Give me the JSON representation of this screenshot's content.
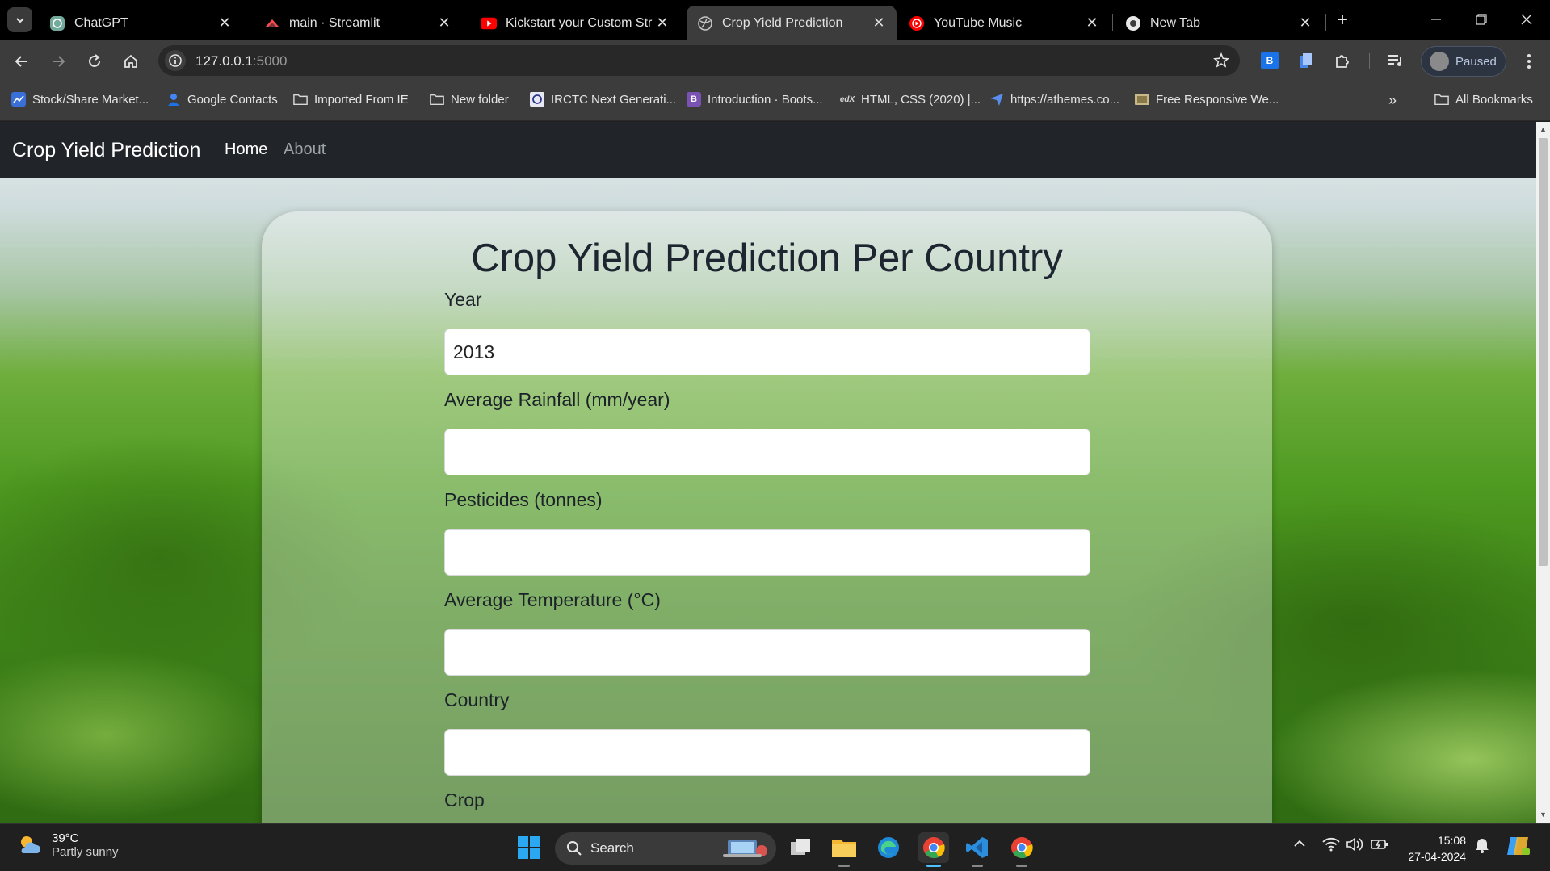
{
  "browser": {
    "tabs": [
      {
        "title": "ChatGPT",
        "icon": "chatgpt-icon",
        "active": false
      },
      {
        "title": "main · Streamlit",
        "icon": "streamlit-icon",
        "active": false
      },
      {
        "title": "Kickstart your Custom Strea",
        "icon": "youtube-icon",
        "active": false
      },
      {
        "title": "Crop Yield Prediction",
        "icon": "globe-icon",
        "active": true
      },
      {
        "title": "YouTube Music",
        "icon": "youtube-music-icon",
        "active": false
      },
      {
        "title": "New Tab",
        "icon": "chrome-icon",
        "active": false
      }
    ],
    "url_host": "127.0.0.1",
    "url_port": ":5000",
    "profile_label": "Paused",
    "extension_letter": "B",
    "bookmarks": [
      {
        "label": "Stock/Share Market...",
        "icon": "stock-icon"
      },
      {
        "label": "Google Contacts",
        "icon": "contacts-icon"
      },
      {
        "label": "Imported From IE",
        "icon": "folder-icon"
      },
      {
        "label": "New folder",
        "icon": "folder-icon"
      },
      {
        "label": "IRCTC Next Generati...",
        "icon": "irctc-icon"
      },
      {
        "label": "Introduction · Boots...",
        "icon": "bootstrap-icon",
        "glyph": "B"
      },
      {
        "label": "HTML, CSS (2020) |...",
        "icon": "edx-icon",
        "glyph": "edX"
      },
      {
        "label": "https://athemes.co...",
        "icon": "athemes-icon"
      },
      {
        "label": "Free Responsive We...",
        "icon": "template-icon"
      }
    ],
    "all_bookmarks": "All Bookmarks"
  },
  "page": {
    "brand": "Crop Yield Prediction",
    "nav": {
      "home": "Home",
      "about": "About"
    },
    "heading": "Crop Yield Prediction Per Country",
    "fields": [
      {
        "label": "Year",
        "value": "2013"
      },
      {
        "label": "Average Rainfall (mm/year)",
        "value": ""
      },
      {
        "label": "Pesticides (tonnes)",
        "value": ""
      },
      {
        "label": "Average Temperature (°C)",
        "value": ""
      },
      {
        "label": "Country",
        "value": ""
      },
      {
        "label": "Crop",
        "value": ""
      }
    ]
  },
  "taskbar": {
    "weather_temp": "39°C",
    "weather_desc": "Partly sunny",
    "search_label": "Search",
    "time": "15:08",
    "date": "27-04-2024"
  },
  "colors": {
    "navbar": "#212529",
    "tab_active": "#3c3c3c",
    "taskbar_accent": "#4cc2ff"
  }
}
